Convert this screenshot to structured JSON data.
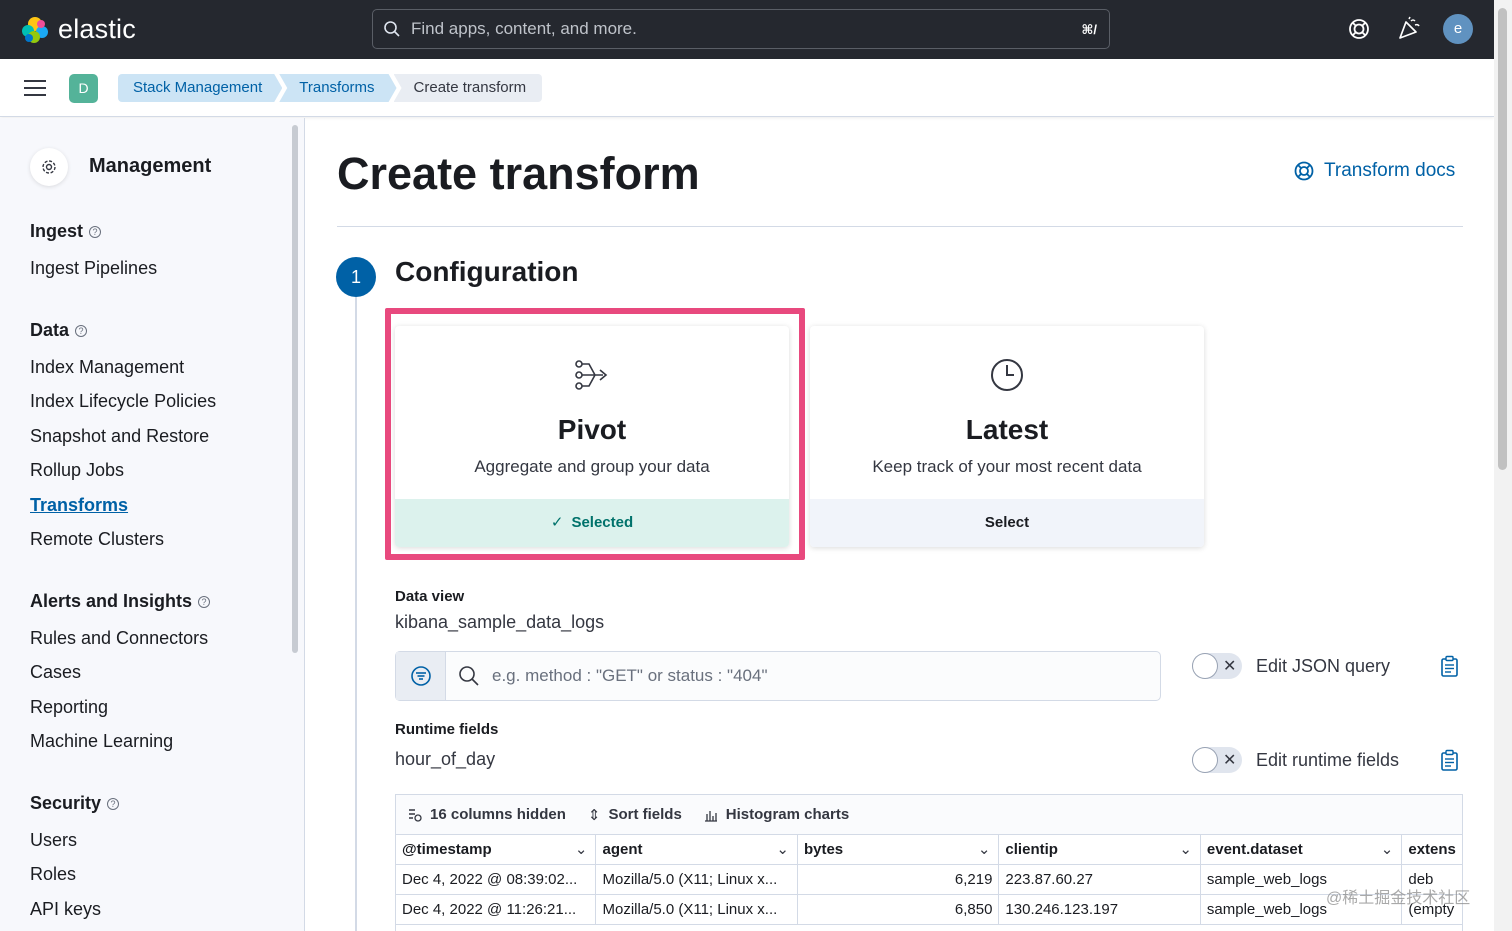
{
  "header": {
    "brand": "elastic",
    "search_placeholder": "Find apps, content, and more.",
    "search_shortcut": "⌘/",
    "avatar_initial": "e"
  },
  "subheader": {
    "space_initial": "D",
    "breadcrumbs": [
      "Stack Management",
      "Transforms",
      "Create transform"
    ]
  },
  "sidebar": {
    "title": "Management",
    "sections": [
      {
        "heading": "Ingest",
        "items": [
          "Ingest Pipelines"
        ]
      },
      {
        "heading": "Data",
        "items": [
          "Index Management",
          "Index Lifecycle Policies",
          "Snapshot and Restore",
          "Rollup Jobs",
          "Transforms",
          "Remote Clusters"
        ]
      },
      {
        "heading": "Alerts and Insights",
        "items": [
          "Rules and Connectors",
          "Cases",
          "Reporting",
          "Machine Learning"
        ]
      },
      {
        "heading": "Security",
        "items": [
          "Users",
          "Roles",
          "API keys"
        ]
      }
    ],
    "active_item": "Transforms"
  },
  "main": {
    "title": "Create transform",
    "docs_link": "Transform docs",
    "step": {
      "number": "1",
      "title": "Configuration"
    },
    "cards": [
      {
        "title": "Pivot",
        "description": "Aggregate and group your data",
        "footer": "Selected",
        "selected": true
      },
      {
        "title": "Latest",
        "description": "Keep track of your most recent data",
        "footer": "Select",
        "selected": false
      }
    ],
    "data_view_label": "Data view",
    "data_view_value": "kibana_sample_data_logs",
    "query_placeholder": "e.g. method : \"GET\" or status : \"404\"",
    "edit_json_label": "Edit JSON query",
    "runtime_fields_label": "Runtime fields",
    "runtime_fields_value": "hour_of_day",
    "edit_runtime_label": "Edit runtime fields",
    "grid": {
      "toolbar": [
        "16 columns hidden",
        "Sort fields",
        "Histogram charts"
      ],
      "columns": [
        "@timestamp",
        "agent",
        "bytes",
        "clientip",
        "event.dataset",
        "extens"
      ],
      "rows": [
        [
          "Dec 4, 2022 @ 08:39:02...",
          "Mozilla/5.0 (X11; Linux x...",
          "6,219",
          "223.87.60.27",
          "sample_web_logs",
          "deb"
        ],
        [
          "Dec 4, 2022 @ 11:26:21...",
          "Mozilla/5.0 (X11; Linux x...",
          "6,850",
          "130.246.123.197",
          "sample_web_logs",
          "(empty"
        ]
      ]
    }
  },
  "watermark": "@稀土掘金技术社区",
  "colors": {
    "accent": "#0061a6",
    "highlight": "#e8497e",
    "selected_bg": "#dcf2ed",
    "selected_text": "#00726b"
  }
}
